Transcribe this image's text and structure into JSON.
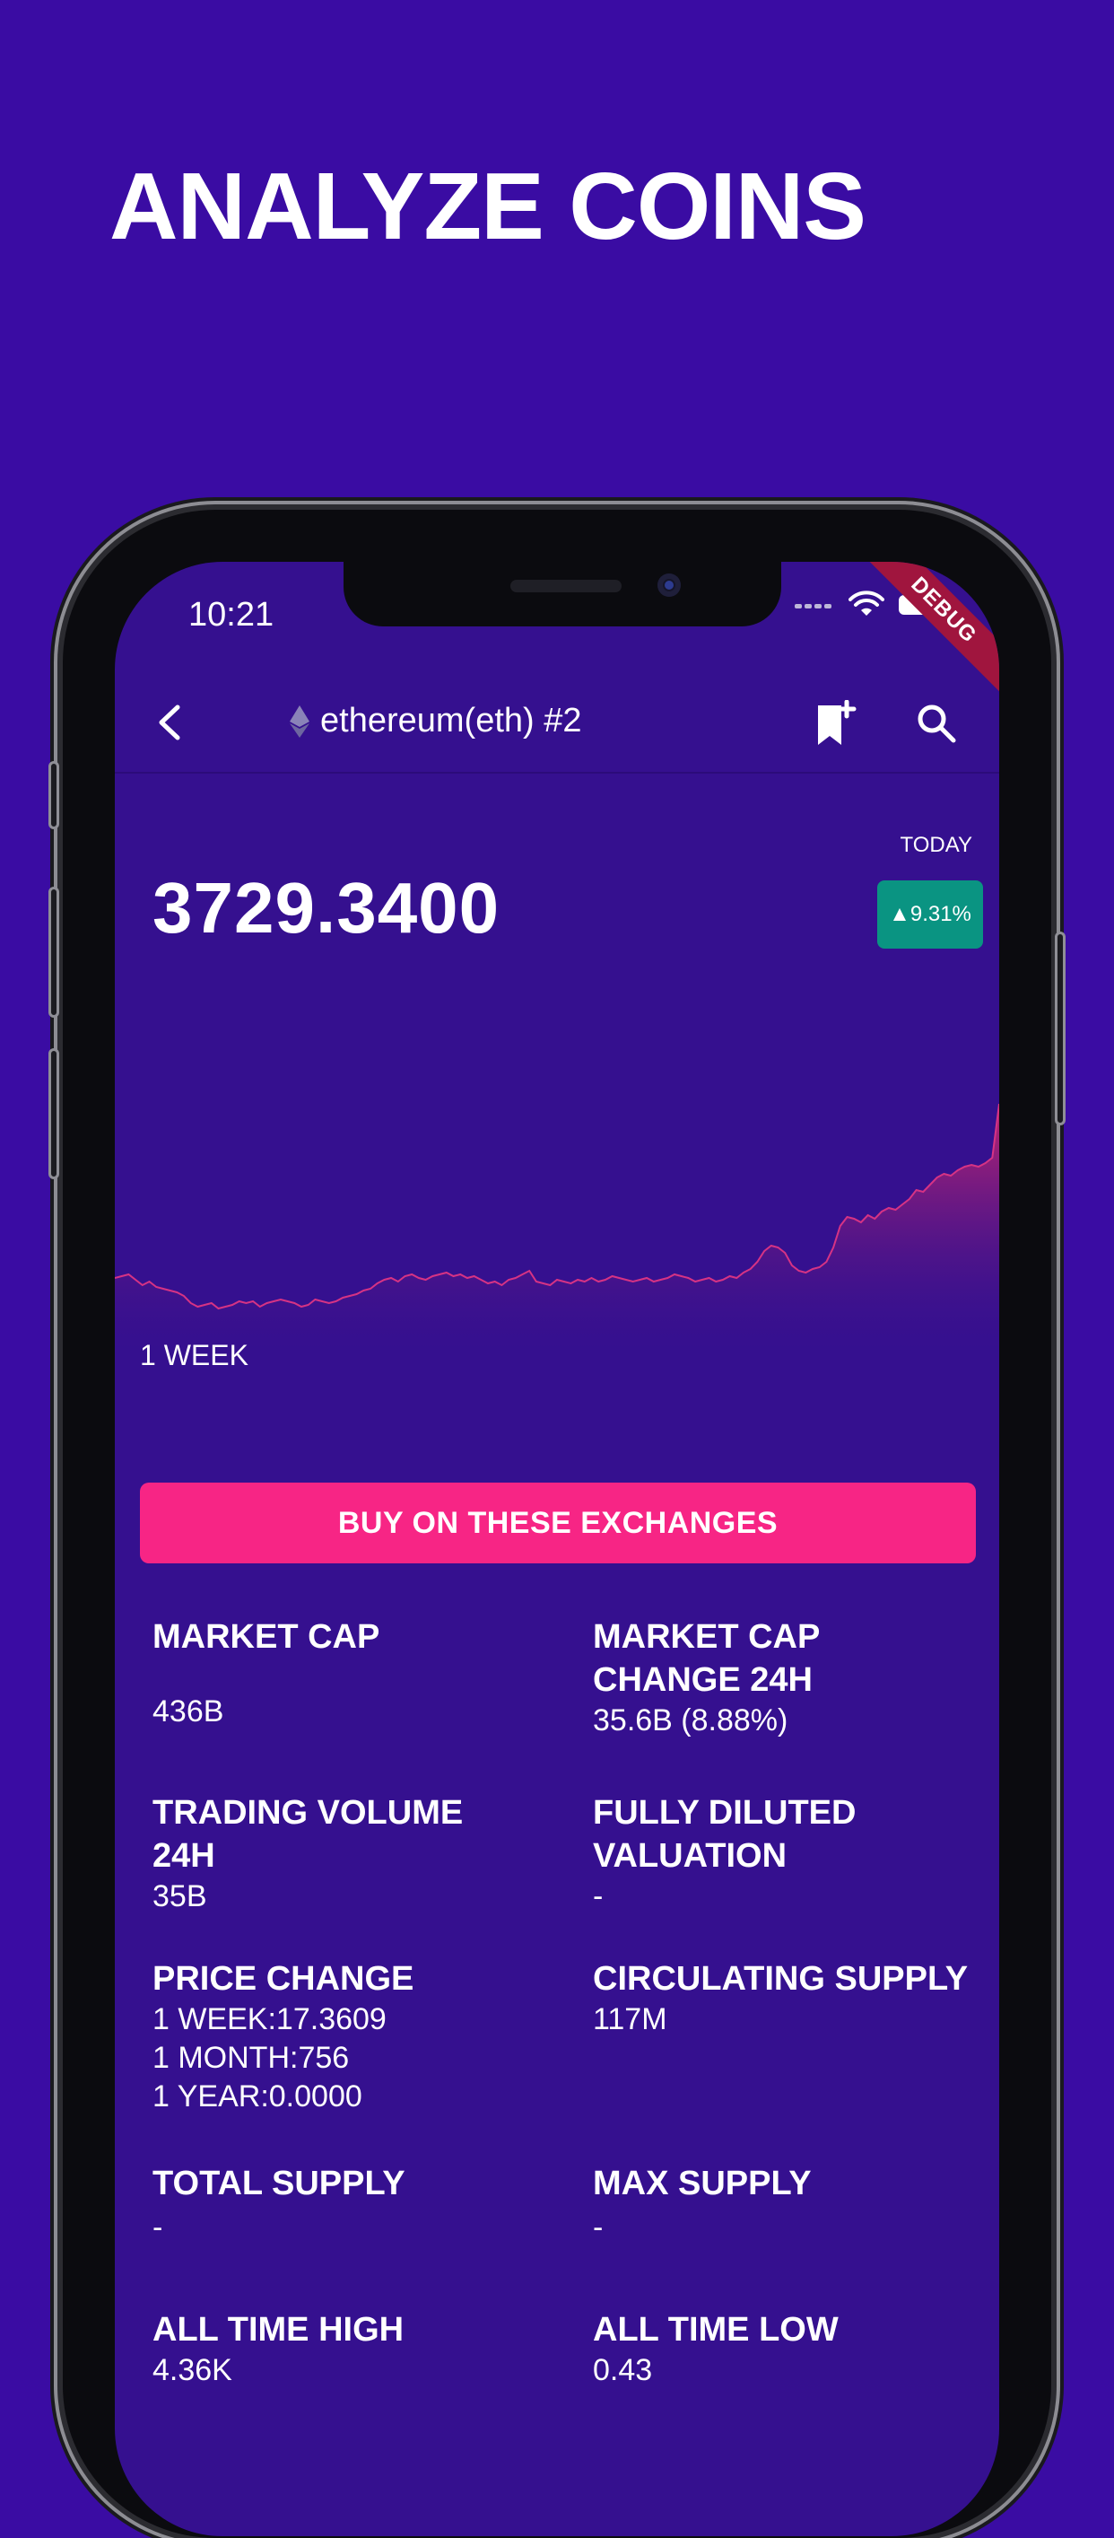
{
  "headline": "ANALYZE COINS",
  "status_bar": {
    "time": "10:21",
    "debug_label": "DEBUG"
  },
  "app_bar": {
    "title": "ethereum(eth) #2"
  },
  "price_panel": {
    "price": "3729.3400",
    "period_label": "TODAY",
    "change_badge": "▲9.31%",
    "change_color": "#0a9482",
    "range_label": "1 WEEK"
  },
  "chart_data": {
    "type": "area",
    "xlabel": "",
    "ylabel": "",
    "values": [
      62,
      64,
      66,
      60,
      54,
      58,
      52,
      50,
      48,
      46,
      42,
      34,
      30,
      32,
      34,
      28,
      30,
      32,
      36,
      34,
      36,
      30,
      34,
      36,
      38,
      36,
      34,
      30,
      32,
      38,
      36,
      34,
      36,
      40,
      42,
      44,
      48,
      50,
      56,
      60,
      62,
      58,
      64,
      66,
      62,
      60,
      64,
      66,
      68,
      64,
      66,
      62,
      64,
      60,
      56,
      58,
      54,
      60,
      62,
      66,
      70,
      58,
      56,
      54,
      60,
      58,
      56,
      60,
      58,
      62,
      58,
      60,
      64,
      62,
      60,
      58,
      60,
      62,
      58,
      60,
      62,
      66,
      64,
      62,
      58,
      60,
      62,
      58,
      60,
      64,
      62,
      68,
      72,
      80,
      92,
      98,
      96,
      90,
      76,
      70,
      68,
      72,
      74,
      80,
      96,
      120,
      130,
      128,
      124,
      132,
      128,
      136,
      140,
      138,
      144,
      150,
      160,
      158,
      166,
      174,
      178,
      176,
      182,
      186,
      188,
      186,
      190,
      196,
      256
    ]
  },
  "buy_button": {
    "label": "BUY ON THESE EXCHANGES"
  },
  "stats": {
    "market_cap": {
      "label": "MARKET CAP",
      "value": "436B"
    },
    "market_cap_change": {
      "label": "MARKET CAP CHANGE 24H",
      "value": "35.6B (8.88%)"
    },
    "trading_volume": {
      "label": "TRADING VOLUME 24H",
      "value": "35B"
    },
    "fdv": {
      "label": "FULLY DILUTED VALUATION",
      "value": "-"
    },
    "price_change": {
      "label": "PRICE CHANGE",
      "week": "1 WEEK:17.3609",
      "month": "1 MONTH:756",
      "year": "1 YEAR:0.0000"
    },
    "circulating_supply": {
      "label": "CIRCULATING SUPPLY",
      "value": "117M"
    },
    "total_supply": {
      "label": "TOTAL SUPPLY",
      "value": "-"
    },
    "max_supply": {
      "label": "MAX SUPPLY",
      "value": "-"
    },
    "ath": {
      "label": "ALL TIME HIGH",
      "value": "4.36K"
    },
    "atl": {
      "label": "ALL TIME LOW",
      "value": "0.43"
    }
  },
  "colors": {
    "background": "#3a0ca3",
    "screen": "#35108f",
    "accent": "#f72585"
  }
}
